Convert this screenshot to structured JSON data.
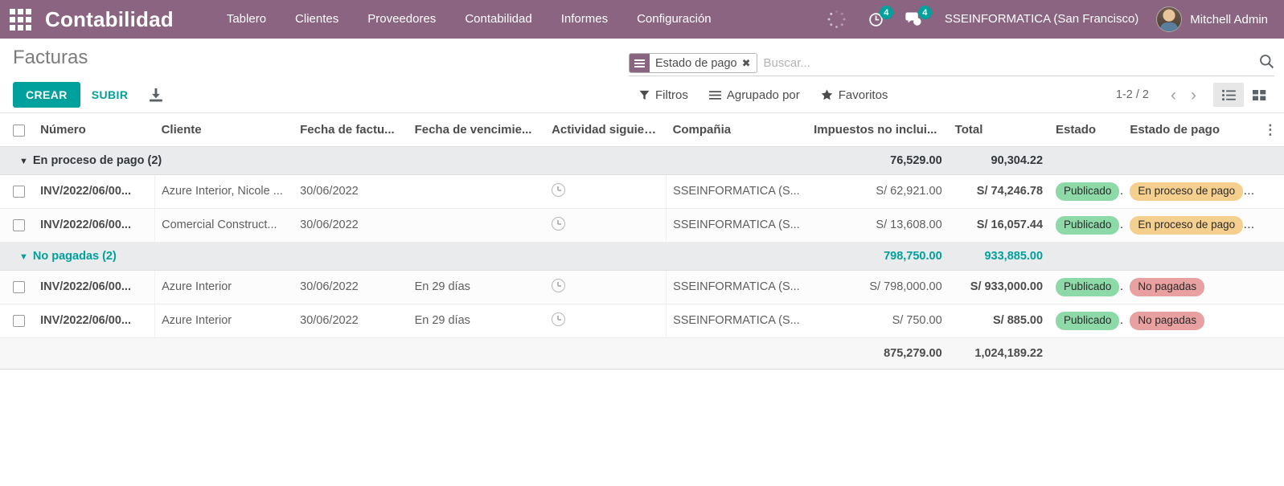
{
  "navbar": {
    "apps_icon": "apps-grid-icon",
    "brand": "Contabilidad",
    "menu": [
      {
        "label": "Tablero"
      },
      {
        "label": "Clientes"
      },
      {
        "label": "Proveedores"
      },
      {
        "label": "Contabilidad"
      },
      {
        "label": "Informes"
      },
      {
        "label": "Configuración"
      }
    ],
    "activity_icon": "clock-activity-icon",
    "activity_count": "4",
    "messages_icon": "chat-bubble-icon",
    "messages_count": "4",
    "company": "SSEINFORMATICA (San Francisco)",
    "user": "Mitchell Admin"
  },
  "control_panel": {
    "title": "Facturas",
    "create_label": "CREAR",
    "upload_label": "SUBIR",
    "import_icon": "download-import-icon",
    "search": {
      "facet_icon": "group-by-icon",
      "facet_label": "Estado de pago",
      "facet_remove": "✖",
      "placeholder": "Buscar...",
      "value": "",
      "search_icon": "search-icon"
    },
    "filters_label": "Filtros",
    "groupby_label": "Agrupado por",
    "favorites_label": "Favoritos",
    "pager": "1-2 / 2",
    "prev_icon": "chevron-left-icon",
    "next_icon": "chevron-right-icon",
    "view_list_icon": "list-view-icon",
    "view_kanban_icon": "kanban-view-icon"
  },
  "table": {
    "headers": {
      "number": "Número",
      "client": "Cliente",
      "invoice_date": "Fecha de factu...",
      "due_date": "Fecha de vencimie...",
      "next_activity": "Actividad siguien...",
      "company": "Compañia",
      "untaxed": "Impuestos no inclui...",
      "total": "Total",
      "state": "Estado",
      "payment_state": "Estado de pago",
      "options_icon": "vertical-dots-icon"
    },
    "groups": [
      {
        "label": "En proceso de pago (2)",
        "color": "dark",
        "untaxed_sum": "76,529.00",
        "total_sum": "90,304.22",
        "rows": [
          {
            "number": "INV/2022/06/00...",
            "client": "Azure Interior, Nicole ...",
            "invoice_date": "30/06/2022",
            "due_date": "",
            "activity_icon": "clock-icon",
            "company": "SSEINFORMATICA (S...",
            "untaxed": "S/ 62,921.00",
            "total": "S/ 74,246.78",
            "state": "Publicado",
            "payment_state": "En proceso de pago",
            "payment_state_color": "orange",
            "trailing": "..."
          },
          {
            "number": "INV/2022/06/00...",
            "client": "Comercial Construct...",
            "invoice_date": "30/06/2022",
            "due_date": "",
            "activity_icon": "clock-icon",
            "company": "SSEINFORMATICA (S...",
            "untaxed": "S/ 13,608.00",
            "total": "S/ 16,057.44",
            "state": "Publicado",
            "payment_state": "En proceso de pago",
            "payment_state_color": "orange",
            "trailing": "..."
          }
        ]
      },
      {
        "label": "No pagadas (2)",
        "color": "teal",
        "untaxed_sum": "798,750.00",
        "total_sum": "933,885.00",
        "rows": [
          {
            "number": "INV/2022/06/00...",
            "client": "Azure Interior",
            "invoice_date": "30/06/2022",
            "due_date": "En 29 días",
            "activity_icon": "clock-icon",
            "company": "SSEINFORMATICA (S...",
            "untaxed": "S/ 798,000.00",
            "total": "S/ 933,000.00",
            "state": "Publicado",
            "payment_state": "No pagadas",
            "payment_state_color": "red",
            "trailing": ""
          },
          {
            "number": "INV/2022/06/00...",
            "client": "Azure Interior",
            "invoice_date": "30/06/2022",
            "due_date": "En 29 días",
            "activity_icon": "clock-icon",
            "company": "SSEINFORMATICA (S...",
            "untaxed": "S/ 750.00",
            "total": "S/ 885.00",
            "state": "Publicado",
            "payment_state": "No pagadas",
            "payment_state_color": "red",
            "trailing": ""
          }
        ]
      }
    ],
    "grand_total": {
      "untaxed": "875,279.00",
      "total": "1,024,189.22"
    }
  },
  "colors": {
    "navbar": "#8a6480",
    "accent": "#00a09d",
    "badge_green": "#8ed9a8",
    "badge_orange": "#f5cf8e",
    "badge_red": "#e8a0a0"
  }
}
